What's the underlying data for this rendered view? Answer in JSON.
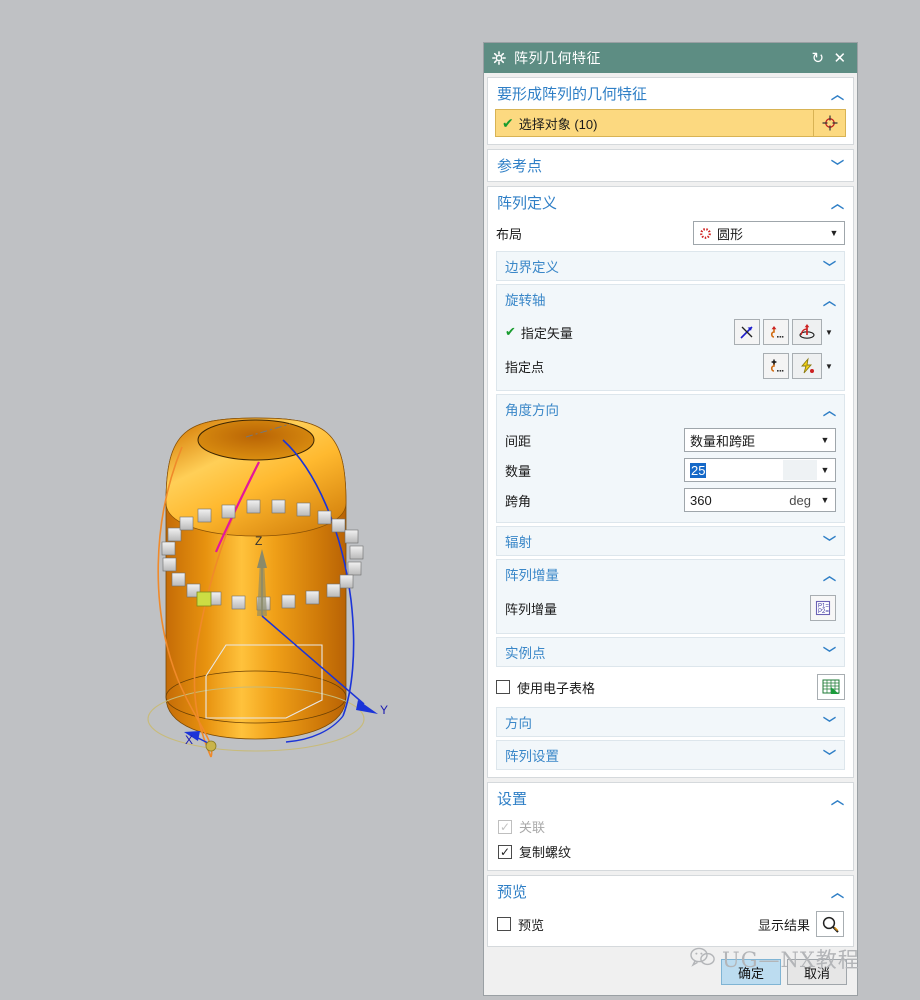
{
  "dialog": {
    "title": "阵列几何特征",
    "title_icon": "gear-icon",
    "reset_icon": "reset-icon",
    "close_icon": "close-icon"
  },
  "sections": {
    "geometry": {
      "header": "要形成阵列的几何特征",
      "select_label": "选择对象 (10)",
      "select_icon": "target-point-icon"
    },
    "reference_point": {
      "header": "参考点"
    },
    "pattern_definition": {
      "header": "阵列定义",
      "layout_label": "布局",
      "layout_value": "圆形",
      "layout_icon": "circular-pattern-icon",
      "boundary": {
        "header": "边界定义"
      },
      "rotation_axis": {
        "header": "旋转轴",
        "vector_label": "指定矢量",
        "point_label": "指定点",
        "vector_icons": [
          "inferred-vector-icon",
          "vector-dialog-icon",
          "vector-constructor-icon"
        ],
        "point_icons": [
          "point-dialog-icon",
          "point-constructor-icon"
        ]
      },
      "angular_direction": {
        "header": "角度方向",
        "spacing_label": "间距",
        "spacing_value": "数量和跨距",
        "count_label": "数量",
        "count_value": "25",
        "span_label": "跨角",
        "span_value": "360",
        "span_unit": "deg"
      },
      "radial": {
        "header": "辐射"
      },
      "increment": {
        "header": "阵列增量",
        "label": "阵列增量",
        "icon": "p1-p2-increment-icon"
      },
      "instance_points": {
        "header": "实例点"
      },
      "spreadsheet": {
        "label": "使用电子表格",
        "checked": false,
        "icon": "spreadsheet-icon"
      },
      "orientation": {
        "header": "方向"
      },
      "pattern_settings": {
        "header": "阵列设置"
      }
    },
    "settings": {
      "header": "设置",
      "associative_label": "关联",
      "associative_checked": true,
      "associative_disabled": true,
      "copy_threads_label": "复制螺纹",
      "copy_threads_checked": true
    },
    "preview": {
      "header": "预览",
      "preview_label": "预览",
      "preview_checked": false,
      "show_result_label": "显示结果",
      "show_result_icon": "magnifier-icon"
    }
  },
  "buttons": {
    "ok": "确定",
    "cancel": "取消"
  },
  "watermark": {
    "text": "UG—NX教程",
    "icon": "wechat-icon"
  },
  "viewport": {
    "axis_x": "X",
    "axis_y": "Y",
    "axis_z": "Z",
    "model": "orange-cylinder-with-circular-cube-pattern",
    "colors": {
      "background": "#bfc1c4",
      "body": "#e8930f",
      "cube": "#d7d7d7",
      "selected_cube": "#ccdd44",
      "axis": "#1a1ad0",
      "curve_pink": "#e5179b",
      "curve_orange": "#f08a2a"
    }
  }
}
